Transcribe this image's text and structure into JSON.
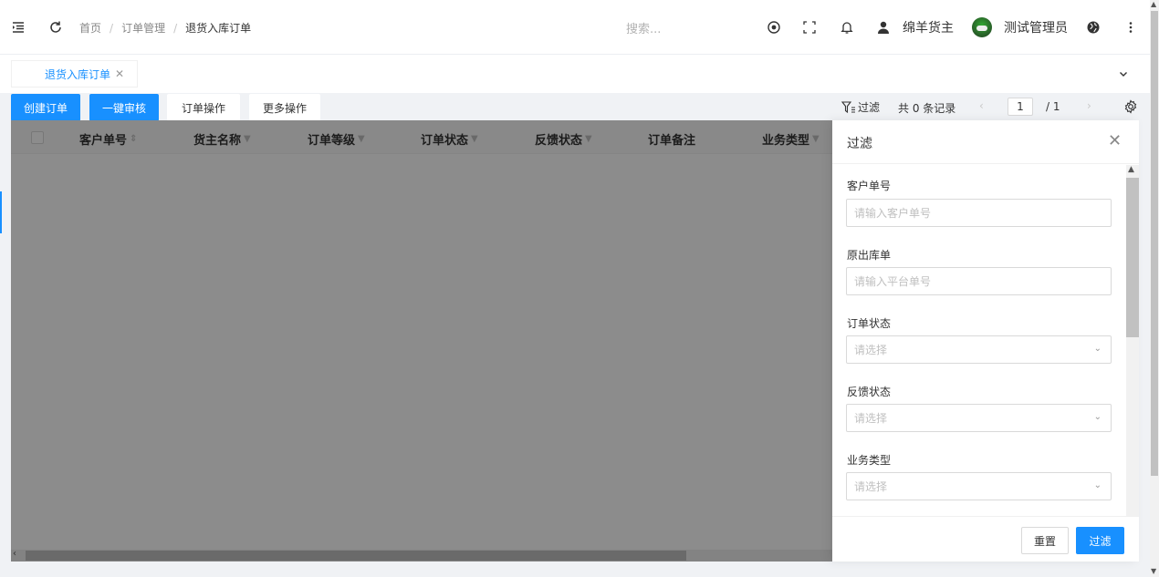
{
  "header": {
    "breadcrumb": [
      "首页",
      "订单管理",
      "退货入库订单"
    ],
    "search_placeholder": "搜索...",
    "owner_name": "绵羊货主",
    "user_name": "测试管理员"
  },
  "tabs": [
    {
      "label": "退货入库订单"
    }
  ],
  "toolbar": {
    "create_label": "创建订单",
    "audit_label": "一键审核",
    "order_ops_label": "订单操作",
    "more_ops_label": "更多操作",
    "filter_label": "过滤",
    "records_text": "共 0 条记录",
    "current_page": "1",
    "total_pages": "/ 1"
  },
  "table": {
    "columns": [
      "客户单号",
      "货主名称",
      "订单等级",
      "订单状态",
      "反馈状态",
      "订单备注",
      "业务类型"
    ]
  },
  "drawer": {
    "title": "过滤",
    "fields": [
      {
        "label": "客户单号",
        "placeholder": "请输入客户单号",
        "type": "text"
      },
      {
        "label": "原出库单",
        "placeholder": "请输入平台单号",
        "type": "text"
      },
      {
        "label": "订单状态",
        "placeholder": "请选择",
        "type": "select"
      },
      {
        "label": "反馈状态",
        "placeholder": "请选择",
        "type": "select"
      },
      {
        "label": "业务类型",
        "placeholder": "请选择",
        "type": "select"
      }
    ],
    "reset_label": "重置",
    "submit_label": "过滤"
  },
  "colors": {
    "primary": "#1890ff",
    "overlay": "rgba(0,0,0,0.45)"
  }
}
